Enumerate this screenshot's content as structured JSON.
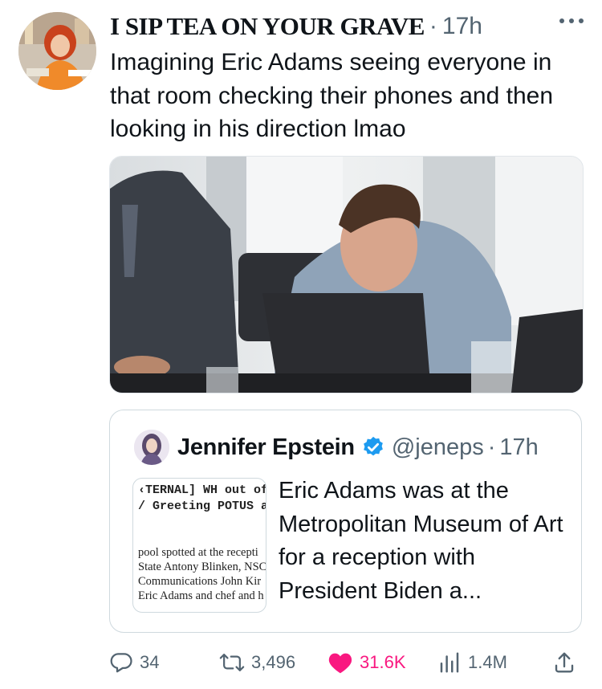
{
  "tweet": {
    "author_name": "I SIP TEA ON YOUR GRAVE",
    "separator": "·",
    "time": "17h",
    "more_label": "···",
    "text": "Imagining Eric Adams seeing everyone in that room checking their phones and then looking in his direction lmao"
  },
  "quote": {
    "author_name": "Jennifer Epstein",
    "handle": "@jeneps",
    "separator": "·",
    "time": "17h",
    "text": "Eric Adams was at the Metropolitan Museum of Art for a reception with President Biden a...",
    "thumbnail": {
      "line1": "‹TERNAL] WH out of ‹",
      "line2": "/ Greeting POTUS at t",
      "para": [
        "pool spotted at the recepti",
        "State Antony Blinken, NSC",
        "Communications John Kir",
        "Eric Adams and chef and h"
      ]
    }
  },
  "actions": {
    "replies": "34",
    "reposts": "3,496",
    "likes": "31.6K",
    "views": "1.4M"
  },
  "colors": {
    "text": "#0f1419",
    "muted": "#536471",
    "like": "#f91880",
    "verified": "#1d9bf0",
    "border": "#cfd9de"
  },
  "icons": [
    "reply-icon",
    "repost-icon",
    "heart-icon",
    "views-icon",
    "share-icon",
    "verified-badge-icon",
    "more-icon"
  ]
}
